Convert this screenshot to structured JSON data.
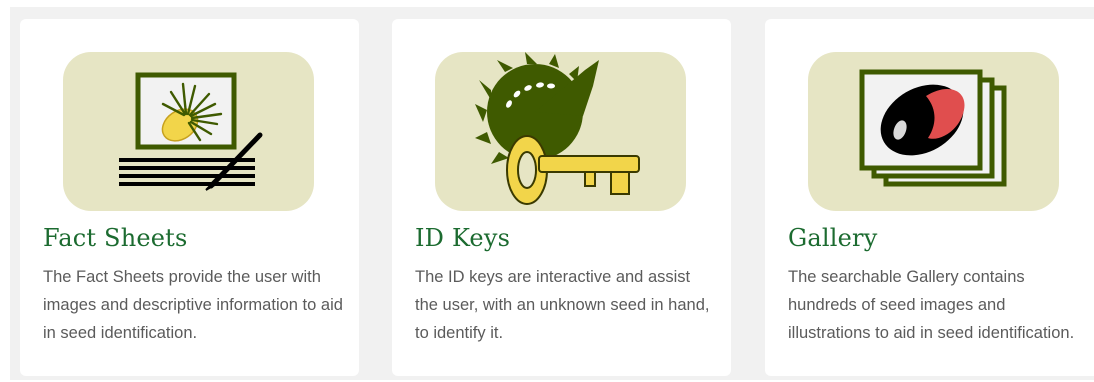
{
  "cards": [
    {
      "title": "Fact Sheets",
      "icon": "fact-sheet-icon",
      "description": "The Fact Sheets provide the user with images and descriptive information to aid in seed identification."
    },
    {
      "title": "ID Keys",
      "icon": "id-key-icon",
      "description": "The ID keys are interactive and assist the user, with an unknown seed in hand, to identify it."
    },
    {
      "title": "Gallery",
      "icon": "gallery-icon",
      "description": "The searchable Gallery contains hundreds of seed images and illustrations to aid in seed identification."
    }
  ],
  "colors": {
    "page_background": "#f1f1f1",
    "card_background": "#ffffff",
    "thumb_background": "#e6e5c4",
    "title": "#1c6b30",
    "body_text": "#5b5b5b",
    "icon_green": "#3f5a00",
    "icon_yellow": "#f2d54a",
    "icon_red": "#e04e4e"
  }
}
